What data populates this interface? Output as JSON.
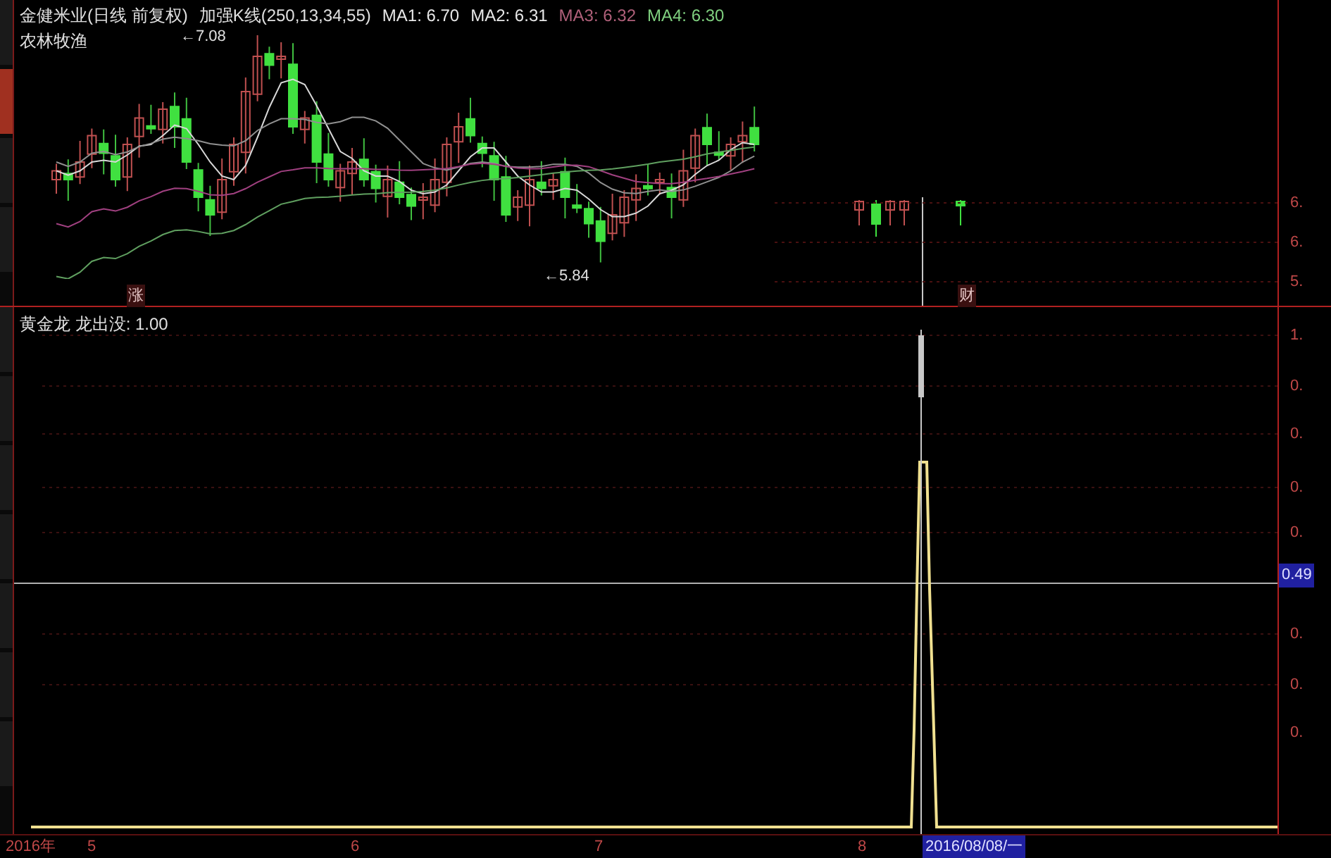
{
  "header": {
    "title": "金健米业(日线 前复权)",
    "indicator": "加强K线(250,13,34,55)",
    "legend": [
      {
        "text": "MA1: 6.70",
        "color": "#e8e8e8"
      },
      {
        "text": "MA2: 6.31",
        "color": "#e8e8e8"
      },
      {
        "text": "MA3: 6.32",
        "color": "#b0607a"
      },
      {
        "text": "MA4: 6.30",
        "color": "#7fd07f"
      }
    ]
  },
  "sector": "农林牧渔",
  "price_chart": {
    "high_label": "←7.08",
    "low_label": "←5.84",
    "markers": [
      "涨",
      "财"
    ],
    "axis_labels": [
      "6.",
      "6.",
      "5."
    ]
  },
  "indicator_panel": {
    "title": "黄金龙 龙出没: 1.00",
    "axis_labels": [
      "1.",
      "0.",
      "0.",
      "0.",
      "0.",
      "0.",
      "0.",
      "0."
    ],
    "cursor_value": "0.49"
  },
  "time_axis": {
    "labels": [
      "2016年",
      "5",
      "6",
      "7",
      "8"
    ],
    "cursor_date": "2016/08/08/一"
  }
}
